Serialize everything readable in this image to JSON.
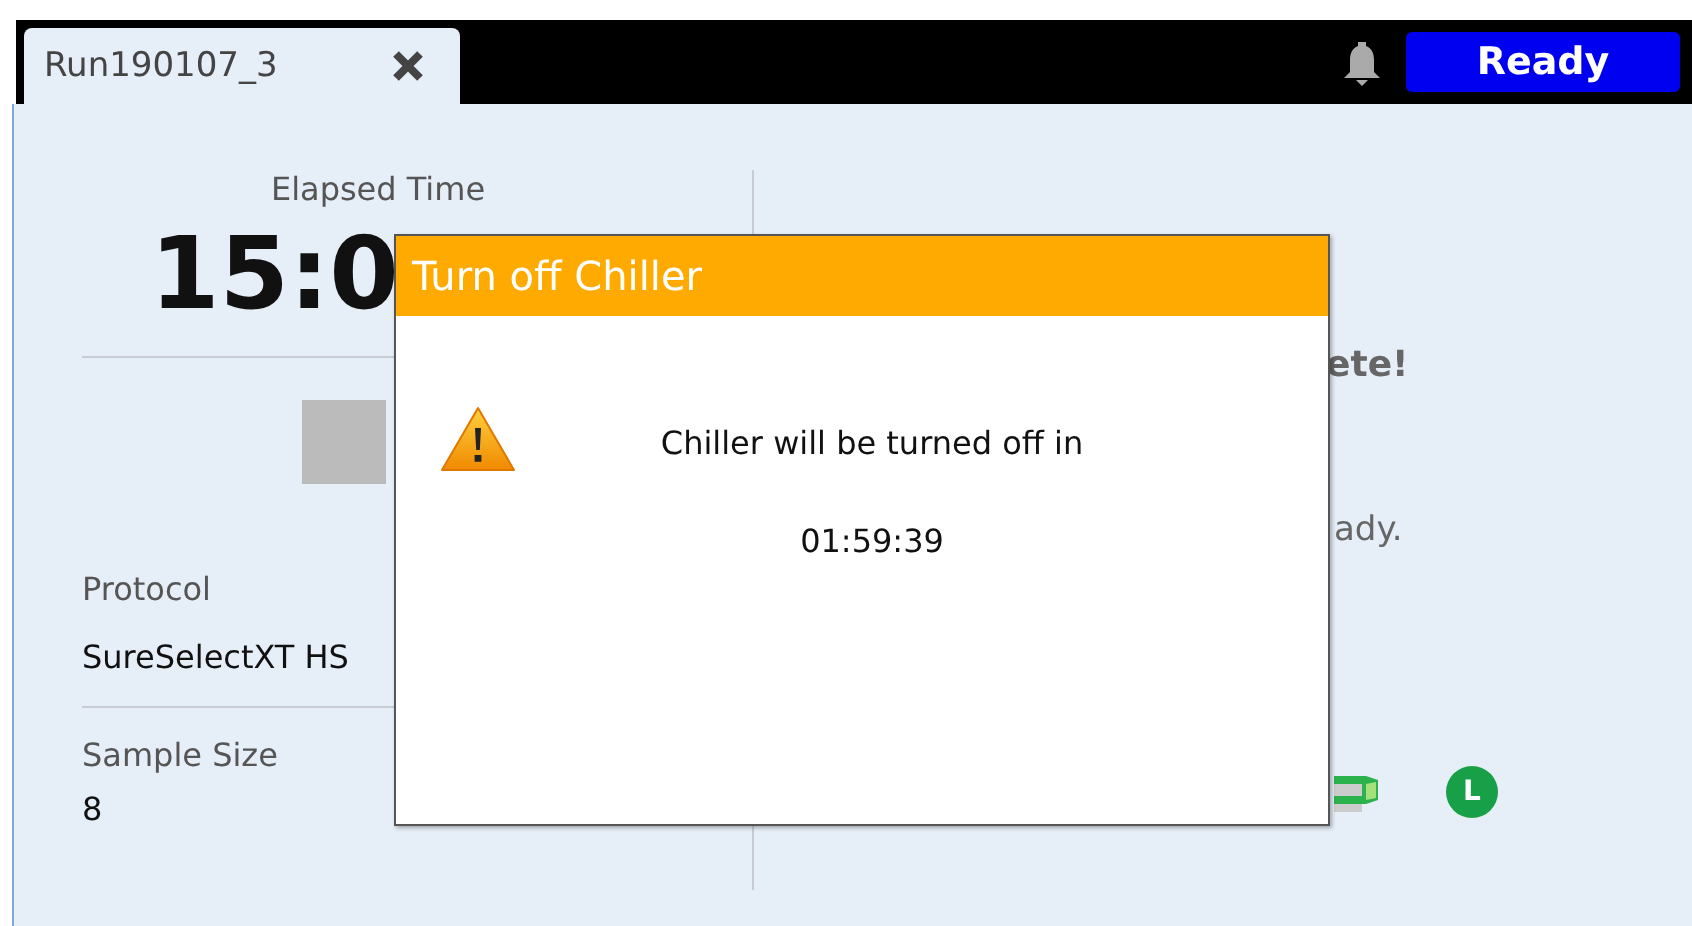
{
  "tabs": [
    {
      "label": "Run190107_3",
      "selected": true
    }
  ],
  "status_button": {
    "label": "Ready"
  },
  "run_panel": {
    "elapsed_label": "Elapsed Time",
    "elapsed_value": "15:0",
    "protocol_label": "Protocol",
    "protocol_value": "SureSelectXT HS",
    "sample_size_label": "Sample Size",
    "sample_size_value": "8"
  },
  "status_panel": {
    "message": "ete!",
    "detail": "ady.",
    "indicator_letter": "L"
  },
  "dialog": {
    "title": "Turn off Chiller",
    "message": "Chiller will be turned off in",
    "countdown": "01:59:39"
  }
}
